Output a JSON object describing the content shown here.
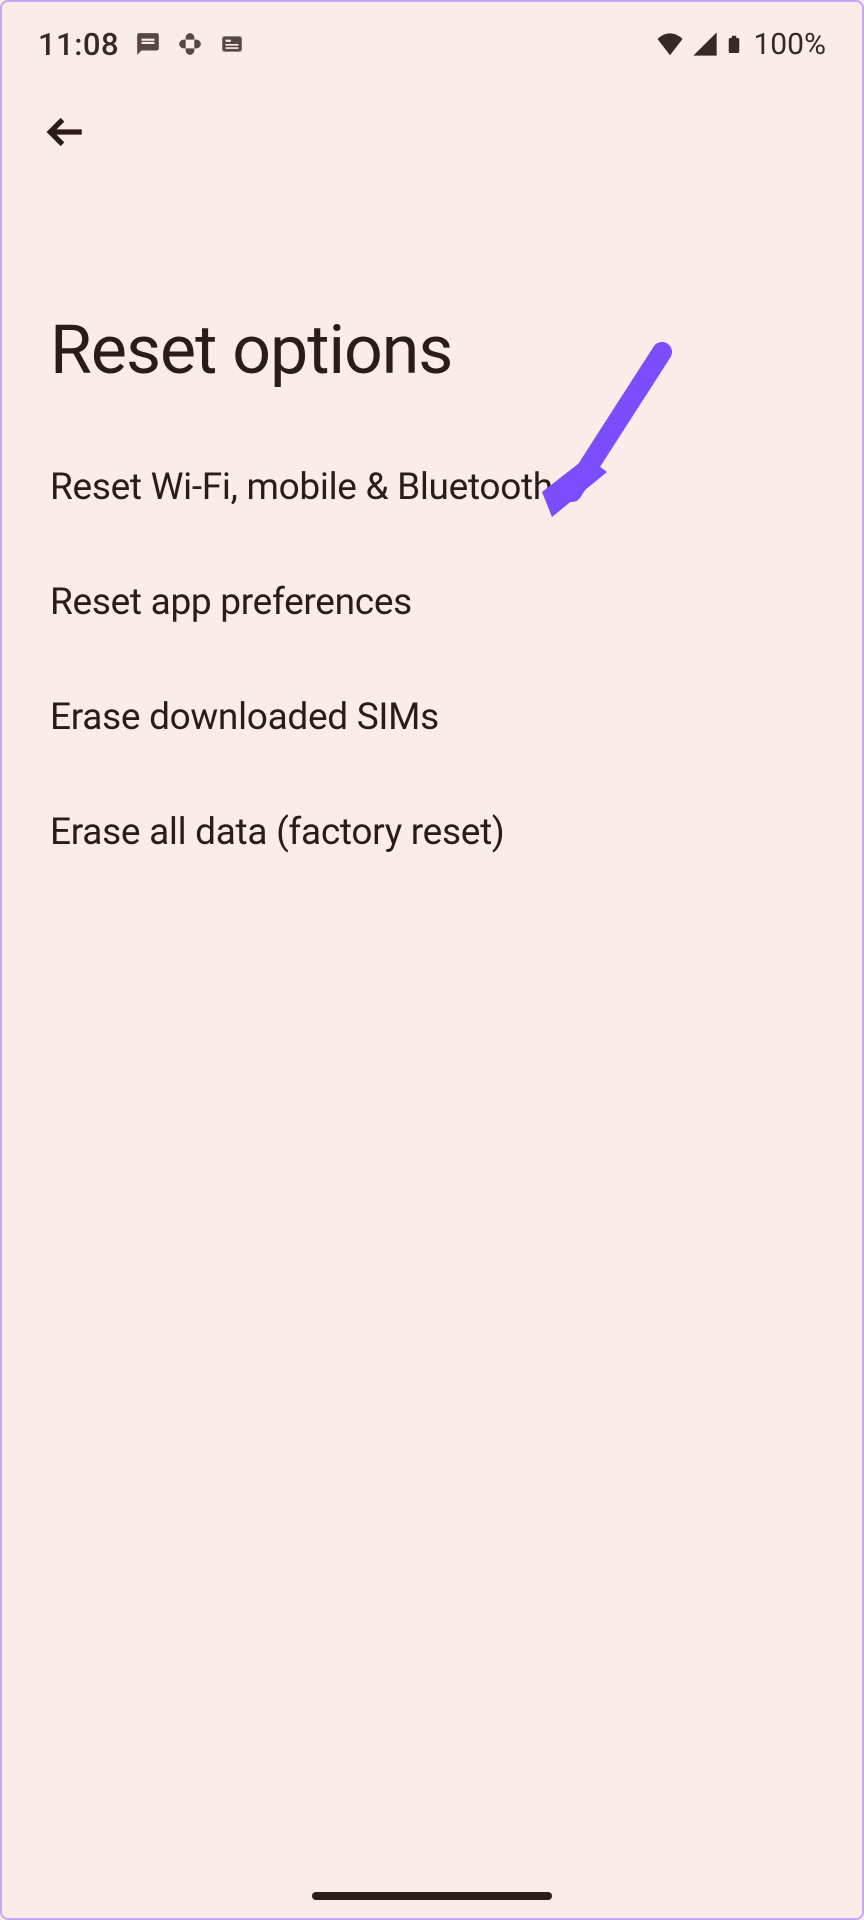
{
  "status_bar": {
    "time": "11:08",
    "battery_percent": "100%"
  },
  "header": {
    "title": "Reset options"
  },
  "options": [
    {
      "label": "Reset Wi-Fi, mobile & Bluetooth"
    },
    {
      "label": "Reset app preferences"
    },
    {
      "label": "Erase downloaded SIMs"
    },
    {
      "label": "Erase all data (factory reset)"
    }
  ],
  "annotation": {
    "arrow_color": "#7c4dff"
  }
}
